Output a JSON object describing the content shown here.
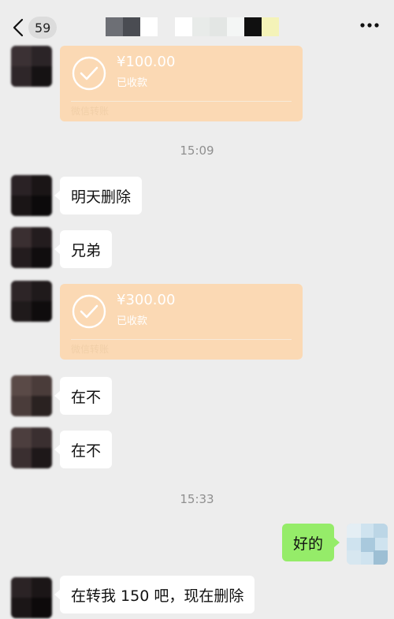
{
  "header": {
    "unread_count": "59"
  },
  "messages": {
    "transfer1": {
      "amount": "¥100.00",
      "status": "已收款",
      "footer": "微信转账"
    },
    "time1": "15:09",
    "msg1": "明天删除",
    "msg2": "兄弟",
    "transfer2": {
      "amount": "¥300.00",
      "status": "已收款",
      "footer": "微信转账"
    },
    "msg3": "在不",
    "msg4": "在不",
    "time2": "15:33",
    "reply": "好的",
    "msg5": "在转我 150 吧，现在删除"
  },
  "icons": {
    "back": "chevron-left-icon",
    "more": "more-dots-icon",
    "transfer": "check-circle-icon"
  },
  "colors": {
    "background": "#ededed",
    "bubble_in": "#ffffff",
    "bubble_out": "#95ec69",
    "transfer_card": "#fbd9b4"
  }
}
